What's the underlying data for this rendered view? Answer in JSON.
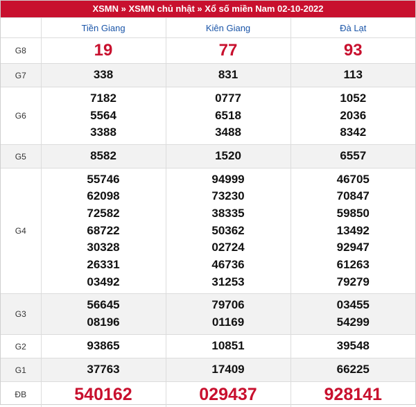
{
  "title": "XSMN » XSMN chủ nhật » Xổ số miền Nam 02-10-2022",
  "provinces": [
    "Tiền Giang",
    "Kiên Giang",
    "Đà Lạt"
  ],
  "colors": {
    "header_bg": "#c8102e",
    "province_text": "#1a55a8",
    "highlight_number": "#c8102e"
  },
  "prizes": [
    {
      "label": "G8",
      "results": [
        [
          "19"
        ],
        [
          "77"
        ],
        [
          "93"
        ]
      ]
    },
    {
      "label": "G7",
      "results": [
        [
          "338"
        ],
        [
          "831"
        ],
        [
          "113"
        ]
      ]
    },
    {
      "label": "G6",
      "results": [
        [
          "7182",
          "5564",
          "3388"
        ],
        [
          "0777",
          "6518",
          "3488"
        ],
        [
          "1052",
          "2036",
          "8342"
        ]
      ]
    },
    {
      "label": "G5",
      "results": [
        [
          "8582"
        ],
        [
          "1520"
        ],
        [
          "6557"
        ]
      ]
    },
    {
      "label": "G4",
      "results": [
        [
          "55746",
          "62098",
          "72582",
          "68722",
          "30328",
          "26331",
          "03492"
        ],
        [
          "94999",
          "73230",
          "38335",
          "50362",
          "02724",
          "46736",
          "31253"
        ],
        [
          "46705",
          "70847",
          "59850",
          "13492",
          "92947",
          "61263",
          "79279"
        ]
      ]
    },
    {
      "label": "G3",
      "results": [
        [
          "56645",
          "08196"
        ],
        [
          "79706",
          "01169"
        ],
        [
          "03455",
          "54299"
        ]
      ]
    },
    {
      "label": "G2",
      "results": [
        [
          "93865"
        ],
        [
          "10851"
        ],
        [
          "39548"
        ]
      ]
    },
    {
      "label": "G1",
      "results": [
        [
          "37763"
        ],
        [
          "17409"
        ],
        [
          "66225"
        ]
      ]
    },
    {
      "label": "ĐB",
      "results": [
        [
          "540162"
        ],
        [
          "029437"
        ],
        [
          "928141"
        ]
      ]
    }
  ]
}
